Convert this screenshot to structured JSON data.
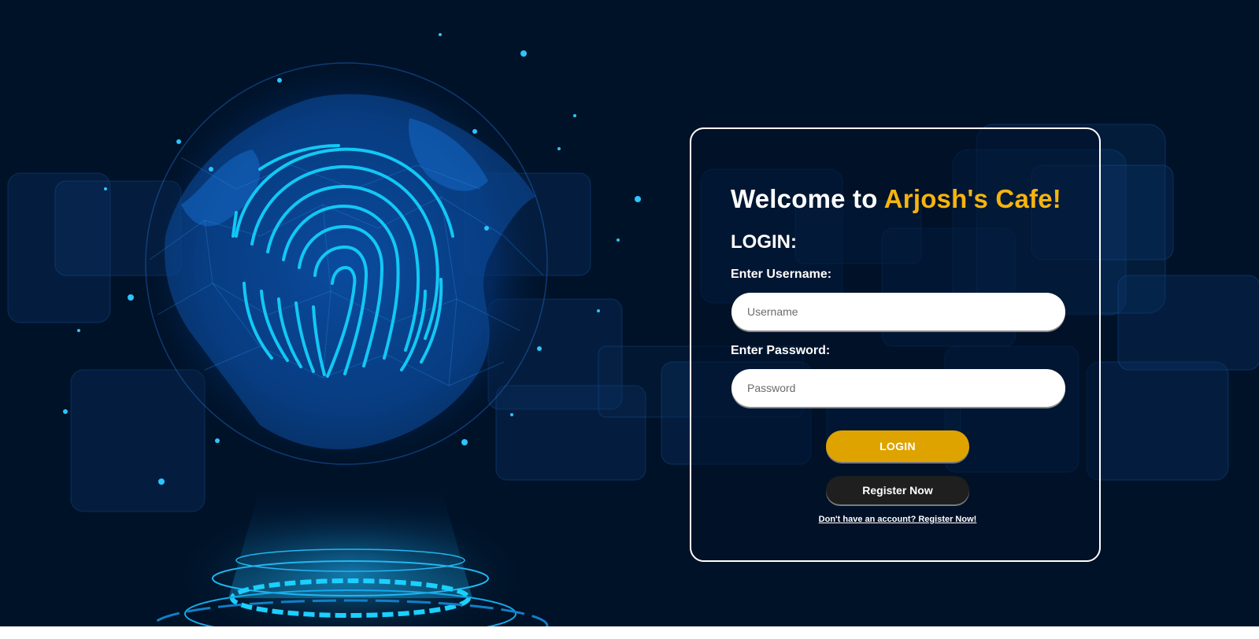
{
  "welcome": {
    "prefix": "Welcome to ",
    "brand": "Arjosh's Cafe!"
  },
  "login_heading": "LOGIN:",
  "username": {
    "label": "Enter Username:",
    "placeholder": "Username",
    "value": ""
  },
  "password": {
    "label": "Enter Password:",
    "placeholder": "Password",
    "value": ""
  },
  "buttons": {
    "login": "LOGIN",
    "register": "Register Now"
  },
  "register_link": "Don't have an account? Register Now!",
  "background": {
    "icons": [
      "globe-icon",
      "fingerprint-icon",
      "hologram-platform-icon"
    ]
  },
  "colors": {
    "background": "#001228",
    "brand": "#f5b50f",
    "login_button": "#dfa300",
    "register_button": "#1f1f1f",
    "fingerprint": "#12c8f5"
  }
}
